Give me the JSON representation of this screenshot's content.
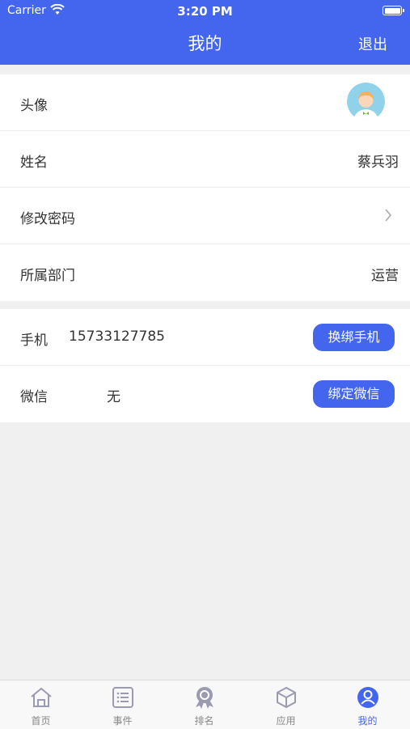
{
  "status_bar": {
    "carrier": "Carrier",
    "time": "3:20 PM"
  },
  "header": {
    "title": "我的",
    "logout_label": "退出"
  },
  "profile": {
    "avatar_label": "头像",
    "name_label": "姓名",
    "name_value": "蔡兵羽",
    "password_label": "修改密码",
    "department_label": "所属部门",
    "department_value": "运营"
  },
  "bindings": {
    "phone_label": "手机",
    "phone_value": "15733127785",
    "phone_button": "换绑手机",
    "wechat_label": "微信",
    "wechat_value": "无",
    "wechat_button": "绑定微信"
  },
  "tabbar": {
    "active": "我的",
    "tabs": [
      {
        "label": "首页",
        "icon": "home-icon"
      },
      {
        "label": "事件",
        "icon": "list-icon"
      },
      {
        "label": "排名",
        "icon": "medal-icon"
      },
      {
        "label": "应用",
        "icon": "cube-icon"
      },
      {
        "label": "我的",
        "icon": "user-icon"
      }
    ]
  },
  "colors": {
    "accent": "#4466ee",
    "background": "#f0f0f0"
  }
}
